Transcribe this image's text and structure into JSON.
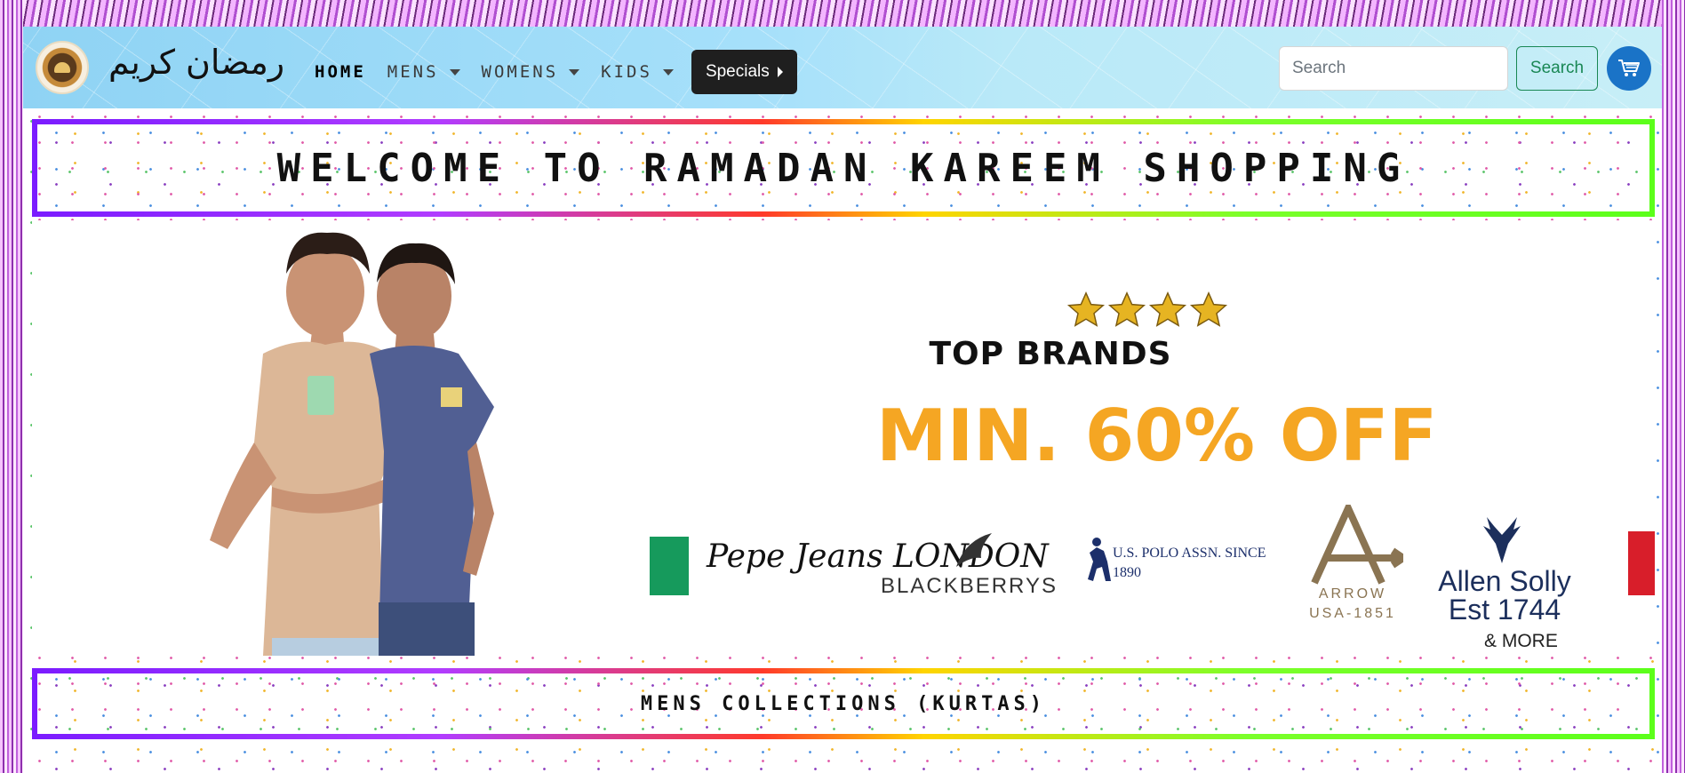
{
  "navbar": {
    "brand": "رمضان كريم",
    "items": [
      {
        "label": "HOME",
        "active": true,
        "dropdown": false
      },
      {
        "label": "MENS",
        "active": false,
        "dropdown": true
      },
      {
        "label": "WOMENS",
        "active": false,
        "dropdown": true
      },
      {
        "label": "KIDS",
        "active": false,
        "dropdown": true
      }
    ],
    "specials_label": "Specials",
    "search_placeholder": "Search",
    "search_button": "Search",
    "cart_icon": "cart-icon"
  },
  "banner_top": {
    "title": "WELCOME TO RAMADAN KAREEM SHOPPING"
  },
  "hero": {
    "stars": 4,
    "heading": "TOP BRANDS",
    "offer": "MIN. 60% OFF",
    "brands": [
      "Pepe Jeans LONDON",
      "BLACKBERRYS",
      "U.S. POLO ASSN. SINCE 1890",
      "ARROW USA-1851",
      "Allen Solly Est 1744"
    ],
    "more": "& MORE"
  },
  "banner_bottom": {
    "title": "MENS COLLECTIONS (KURTAS)"
  },
  "colors": {
    "accent_orange": "#f5a623",
    "search_green": "#198754",
    "cart_blue": "#1a73c7",
    "specials_dark": "#1f1f1f"
  }
}
